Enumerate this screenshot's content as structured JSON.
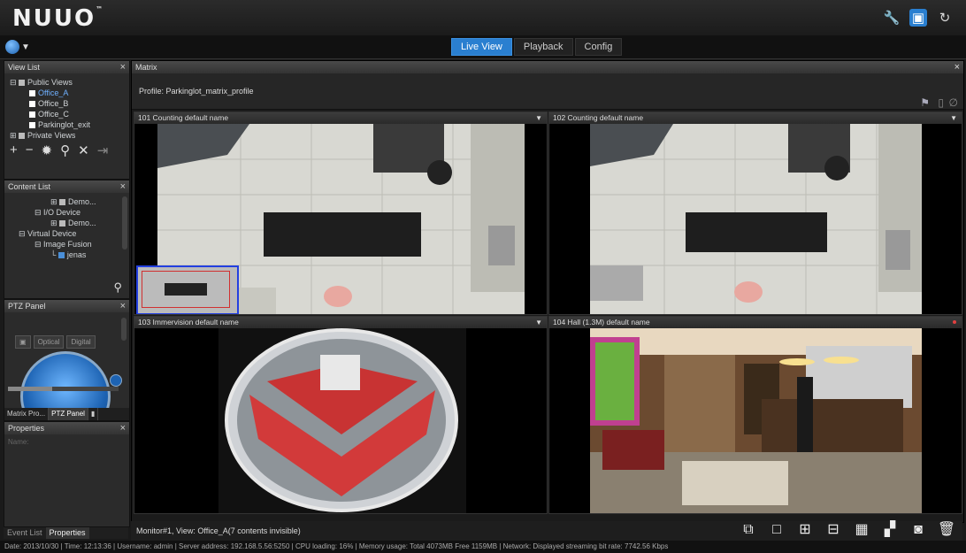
{
  "app": {
    "logo": "NUUO",
    "trademark": "™"
  },
  "topbar": {
    "icons": [
      "wrench-icon",
      "monitor-icon",
      "refresh-icon"
    ]
  },
  "nav": {
    "tabs": [
      "Live View",
      "Playback",
      "Config"
    ],
    "active_tab": "Live View"
  },
  "view_list": {
    "title": "View List",
    "public_label": "Public Views",
    "items": [
      "Office_A",
      "Office_B",
      "Office_C",
      "Parkinglot_exit"
    ],
    "private_label": "Private Views"
  },
  "content_list": {
    "title": "Content List",
    "items": [
      "Demo...",
      "I/O Device",
      "Demo...",
      "Virtual Device",
      "Image Fusion",
      "jenas"
    ]
  },
  "ptz": {
    "title": "PTZ Panel",
    "buttons": [
      "Optical",
      "Digital"
    ],
    "tabs": [
      "Matrix Pro...",
      "PTZ Panel"
    ]
  },
  "properties": {
    "title": "Properties",
    "name_label": "Name:"
  },
  "bottom_tabs": [
    "Event List",
    "Properties"
  ],
  "matrix": {
    "title": "Matrix",
    "profile": "Profile: Parkinglot_matrix_profile",
    "cells": [
      {
        "title": "101 Counting  default name"
      },
      {
        "title": "102 Counting  default name"
      },
      {
        "title": "103 Immervision  default name"
      },
      {
        "title": "104 Hall (1.3M)  default name"
      }
    ]
  },
  "status": {
    "monitor": "Monitor#1, View: Office_A(7 contents invisible)"
  },
  "footer": {
    "text": "Date: 2013/10/30 | Time: 12:13:36 | Username: admin | Server address: 192.168.5.56:5250 | CPU loading: 16% | Memory usage: Total 4073MB Free 1159MB | Network: Displayed streaming bit rate: 7742.56 Kbps"
  },
  "colors": {
    "accent": "#2a7fd0",
    "bg": "#1a1a1a",
    "fisheye_red": "#d23a3a"
  }
}
